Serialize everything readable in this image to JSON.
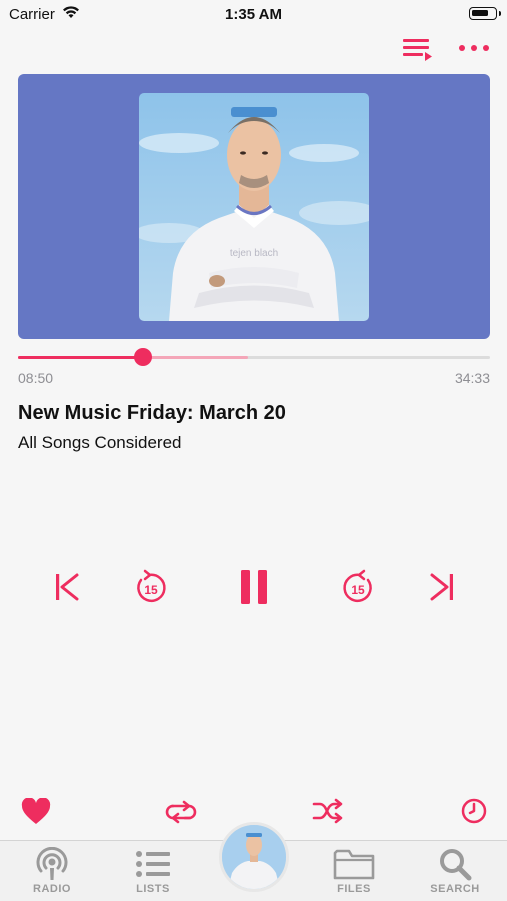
{
  "status_bar": {
    "carrier": "Carrier",
    "time": "1:35 AM"
  },
  "player": {
    "elapsed": "08:50",
    "total": "34:33",
    "progress_fraction": 0.256,
    "buffered_fraction": 0.487,
    "title": "New Music Friday: March 20",
    "show": "All Songs Considered",
    "album_shirt_text": "tejen blach"
  },
  "tabs": [
    {
      "label": "RADIO",
      "icon": "podcast-icon"
    },
    {
      "label": "LISTS",
      "icon": "list-icon"
    },
    {
      "label": "FILES",
      "icon": "folder-icon"
    },
    {
      "label": "SEARCH",
      "icon": "search-icon"
    }
  ],
  "colors": {
    "accent": "#ee2d5f",
    "art_background": "#6577c4",
    "tab_inactive": "#9a9a9a",
    "background": "#f6f6f6"
  }
}
